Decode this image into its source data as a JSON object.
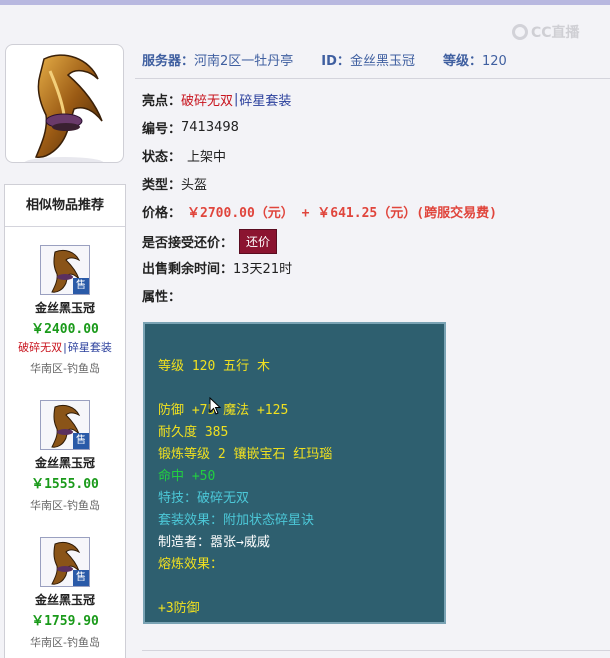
{
  "watermark": {
    "text": "CC直播"
  },
  "header": {
    "server_label": "服务器：",
    "server_value": "河南2区一牡丹亭",
    "id_label": "ID：",
    "id_value": "金丝黑玉冠",
    "level_label": "等级：",
    "level_value": "120"
  },
  "details": {
    "highlight_label": "亮点：",
    "highlight_tag1": "破碎无双",
    "highlight_sep": "|",
    "highlight_tag2": "碎星套装",
    "number_label": "编号：",
    "number_value": "7413498",
    "status_label": "状态：",
    "status_value": "上架中",
    "type_label": "类型：",
    "type_value": "头盔",
    "price_label": "价格：",
    "price_value": "￥2700.00（元） + ￥641.25（元）(跨服交易费)",
    "bargain_label": "是否接受还价：",
    "bargain_button": "还价",
    "time_label": "出售剩余时间：",
    "time_value": "13天21时",
    "attr_label": "属性："
  },
  "attributes": [
    {
      "text": "等级 120 五行 木",
      "color": "#f0e020"
    },
    {
      "text": "防御 +75 魔法 +125",
      "color": "#f0e020"
    },
    {
      "text": "耐久度 385",
      "color": "#f0e020"
    },
    {
      "text": "锻炼等级 2 镶嵌宝石 红玛瑙",
      "color": "#f0e020"
    },
    {
      "text": "命中 +50",
      "color": "#22d040"
    },
    {
      "text": "特技：破碎无双",
      "color": "#4cc8d8"
    },
    {
      "text": "套装效果：附加状态碎星诀",
      "color": "#4cc8d8"
    },
    {
      "text": "制造者：嚣张→威威",
      "color": "#ffffff"
    },
    {
      "text": "熔炼效果：",
      "color": "#f0e020"
    },
    {
      "text": "+3防御",
      "color": "#f0e020"
    }
  ],
  "sidebar": {
    "title": "相似物品推荐",
    "items": [
      {
        "name": "金丝黑玉冠",
        "price": "￥2400.00",
        "tag1": "破碎无双",
        "sep": "|",
        "tag2": "碎星套装",
        "server": "华南区-钓鱼岛",
        "badge": "售"
      },
      {
        "name": "金丝黑玉冠",
        "price": "￥1555.00",
        "server": "华南区-钓鱼岛",
        "badge": "售"
      },
      {
        "name": "金丝黑玉冠",
        "price": "￥1759.90",
        "server": "华南区-钓鱼岛",
        "badge": "售"
      }
    ]
  }
}
